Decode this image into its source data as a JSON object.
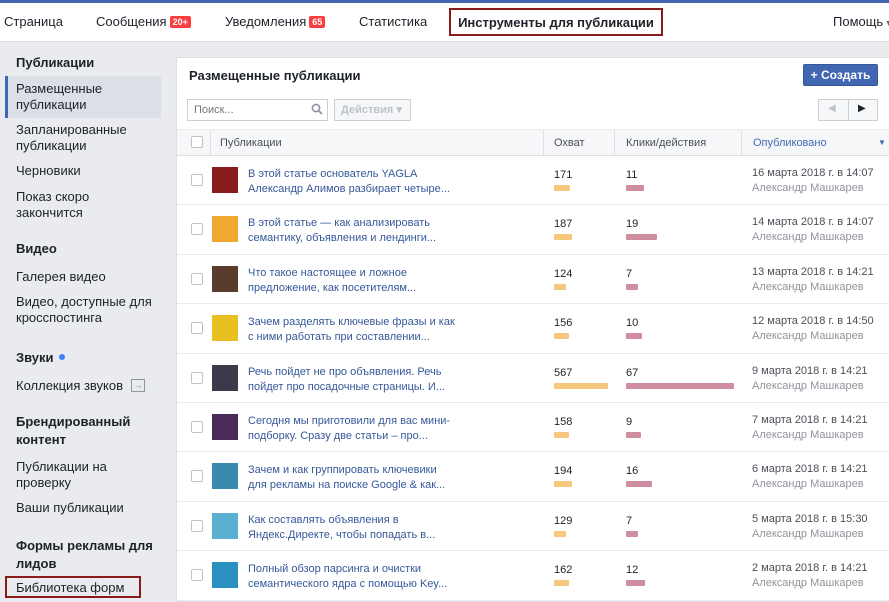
{
  "topnav": {
    "tabs": [
      {
        "label": "Страница",
        "badge": ""
      },
      {
        "label": "Сообщения",
        "badge": "20+"
      },
      {
        "label": "Уведомления",
        "badge": "65"
      },
      {
        "label": "Статистика",
        "badge": ""
      }
    ],
    "active_tab": "Инструменты для публикации",
    "help": "Помощь"
  },
  "sidebar": {
    "publications": {
      "heading": "Публикации",
      "items": [
        "Размещенные публикации",
        "Запланированные публикации",
        "Черновики",
        "Показ скоро закончится"
      ]
    },
    "video": {
      "heading": "Видео",
      "items": [
        "Галерея видео",
        "Видео, доступные для кросспостинга"
      ]
    },
    "sounds": {
      "heading": "Звуки",
      "items": [
        "Коллекция звуков"
      ]
    },
    "branded": {
      "heading": "Брендированный контент",
      "items": [
        "Публикации на проверку",
        "Ваши публикации"
      ]
    },
    "leadforms": {
      "heading": "Формы рекламы для лидов",
      "items": [
        "Библиотека форм"
      ]
    }
  },
  "main": {
    "title": "Размещенные публикации",
    "create_button": "Создать",
    "search_placeholder": "Поиск...",
    "actions_label": "Действия",
    "columns": [
      "Публикации",
      "Охват",
      "Клики/действия",
      "Опубликовано"
    ],
    "colors": {
      "reach_bar": "#f7c77d",
      "clicks_bar": "#cf8ea0",
      "accent": "#4267b2"
    },
    "max_reach": 567,
    "max_clicks": 67,
    "rows": [
      {
        "title": "В этой статье основатель YAGLA Александр Алимов разбирает четыре...",
        "reach": 171,
        "clicks": 11,
        "date": "16 марта 2018 г. в 14:07",
        "author": "Александр Машкарев",
        "thumb": "#8a1c1c"
      },
      {
        "title": "В этой статье — как анализировать семантику, объявления и лендинги...",
        "reach": 187,
        "clicks": 19,
        "date": "14 марта 2018 г. в 14:07",
        "author": "Александр Машкарев",
        "thumb": "#f0a830"
      },
      {
        "title": "Что такое настоящее и ложное предложение, как посетителям...",
        "reach": 124,
        "clicks": 7,
        "date": "13 марта 2018 г. в 14:21",
        "author": "Александр Машкарев",
        "thumb": "#5a3c2c"
      },
      {
        "title": "Зачем разделять ключевые фразы и как с ними работать при составлении...",
        "reach": 156,
        "clicks": 10,
        "date": "12 марта 2018 г. в 14:50",
        "author": "Александр Машкарев",
        "thumb": "#e8c020"
      },
      {
        "title": "Речь пойдет не про объявления. Речь пойдет про посадочные страницы. И...",
        "reach": 567,
        "clicks": 67,
        "date": "9 марта 2018 г. в 14:21",
        "author": "Александр Машкарев",
        "thumb": "#3a3a4a"
      },
      {
        "title": "Сегодня мы приготовили для вас мини-подборку. Сразу две статьи – про...",
        "reach": 158,
        "clicks": 9,
        "date": "7 марта 2018 г. в 14:21",
        "author": "Александр Машкарев",
        "thumb": "#4a2a5a"
      },
      {
        "title": "Зачем и как группировать ключевики для рекламы на поиске Google & как...",
        "reach": 194,
        "clicks": 16,
        "date": "6 марта 2018 г. в 14:21",
        "author": "Александр Машкарев",
        "thumb": "#3a8ab0"
      },
      {
        "title": "Как составлять объявления в Яндекс.Директе, чтобы попадать в...",
        "reach": 129,
        "clicks": 7,
        "date": "5 марта 2018 г. в 15:30",
        "author": "Александр Машкарев",
        "thumb": "#5ab0d0"
      },
      {
        "title": "Полный обзор парсинга и очистки семантического ядра с помощью Key...",
        "reach": 162,
        "clicks": 12,
        "date": "2 марта 2018 г. в 14:21",
        "author": "Александр Машкарев",
        "thumb": "#2a90c0"
      }
    ]
  }
}
